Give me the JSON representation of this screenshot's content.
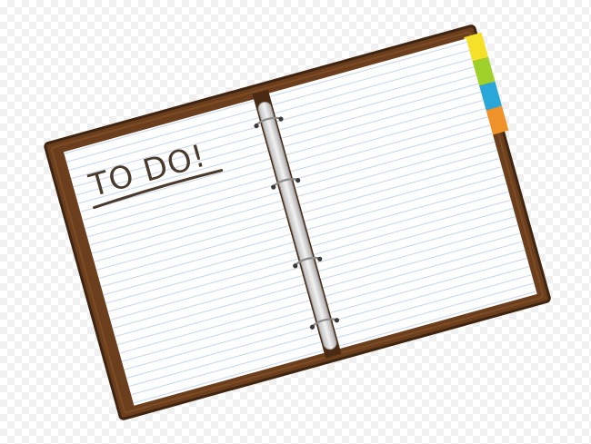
{
  "notebook": {
    "heading": "TO DO!",
    "colors": {
      "cover": "#6b3f1d",
      "cover_edge": "#3f2410",
      "page": "#ffffff",
      "rule_line": "#c7d6ea",
      "ring": "#8a8a8a",
      "ink": "#4a3a2c"
    },
    "tabs": [
      {
        "name": "yellow-tab",
        "color": "#f5e12a"
      },
      {
        "name": "green-tab",
        "color": "#9fd12a"
      },
      {
        "name": "blue-tab",
        "color": "#2aa7d8"
      },
      {
        "name": "orange-tab",
        "color": "#f0922a"
      }
    ]
  }
}
